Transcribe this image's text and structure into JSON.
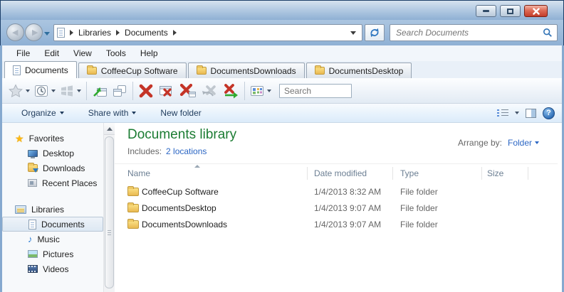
{
  "colors": {
    "title_green": "#1c7c33",
    "link_blue": "#2b66c4",
    "close_button_red": "#c23d2a",
    "commandbar_text": "#1f3b5c",
    "column_header_text": "#6c7f93",
    "frame_blue": "#8fb0d4"
  },
  "icons": {
    "titlebar": [
      "minimize-icon",
      "restore-icon",
      "close-icon"
    ],
    "navbar": [
      "back-icon",
      "forward-icon",
      "recent-pages-chevron-icon",
      "page-icon",
      "breadcrumb-arrow-icon",
      "address-dropdown-icon",
      "refresh-icon",
      "search-icon"
    ],
    "toolbar": [
      "favorites-star-icon",
      "history-clock-icon",
      "apps-windows-icon",
      "open-new-window-icon",
      "clone-tab-icon",
      "close-tab-icon",
      "close-window-icon",
      "close-others-icon",
      "undo-close-icon",
      "reopen-tab-icon",
      "view-grid-icon"
    ],
    "commandbar": [
      "list-view-icon",
      "view-dropdown-icon",
      "preview-pane-icon",
      "help-icon"
    ]
  },
  "navbar": {
    "breadcrumb": [
      "Libraries",
      "Documents"
    ],
    "search_placeholder": "Search Documents"
  },
  "menubar": {
    "items": [
      "File",
      "Edit",
      "View",
      "Tools",
      "Help"
    ]
  },
  "tabbar": {
    "tabs": [
      {
        "label": "Documents",
        "icon": "page",
        "active": true
      },
      {
        "label": "CoffeeCup Software",
        "icon": "folder",
        "active": false
      },
      {
        "label": "DocumentsDownloads",
        "icon": "folder",
        "active": false
      },
      {
        "label": "DocumentsDesktop",
        "icon": "folder",
        "active": false
      }
    ]
  },
  "toolbar": {
    "search_placeholder": "Search"
  },
  "commandbar": {
    "organize": "Organize",
    "share_with": "Share with",
    "new_folder": "New folder"
  },
  "sidebar": {
    "sections": [
      {
        "label": "Favorites",
        "items": [
          {
            "label": "Desktop",
            "icon": "monitor"
          },
          {
            "label": "Downloads",
            "icon": "folder-download"
          },
          {
            "label": "Recent Places",
            "icon": "recent-places"
          }
        ]
      },
      {
        "label": "Libraries",
        "items": [
          {
            "label": "Documents",
            "icon": "page",
            "selected": true
          },
          {
            "label": "Music",
            "icon": "music-note"
          },
          {
            "label": "Pictures",
            "icon": "picture"
          },
          {
            "label": "Videos",
            "icon": "film"
          }
        ]
      }
    ]
  },
  "main": {
    "title": "Documents library",
    "includes_label": "Includes:",
    "includes_link": "2 locations",
    "arrange_label": "Arrange by:",
    "arrange_value": "Folder",
    "columns": [
      "Name",
      "Date modified",
      "Type",
      "Size"
    ],
    "rows": [
      {
        "name": "CoffeeCup Software",
        "date_modified": "1/4/2013 8:32 AM",
        "type": "File folder",
        "size": ""
      },
      {
        "name": "DocumentsDesktop",
        "date_modified": "1/4/2013 9:07 AM",
        "type": "File folder",
        "size": ""
      },
      {
        "name": "DocumentsDownloads",
        "date_modified": "1/4/2013 9:07 AM",
        "type": "File folder",
        "size": ""
      }
    ]
  }
}
